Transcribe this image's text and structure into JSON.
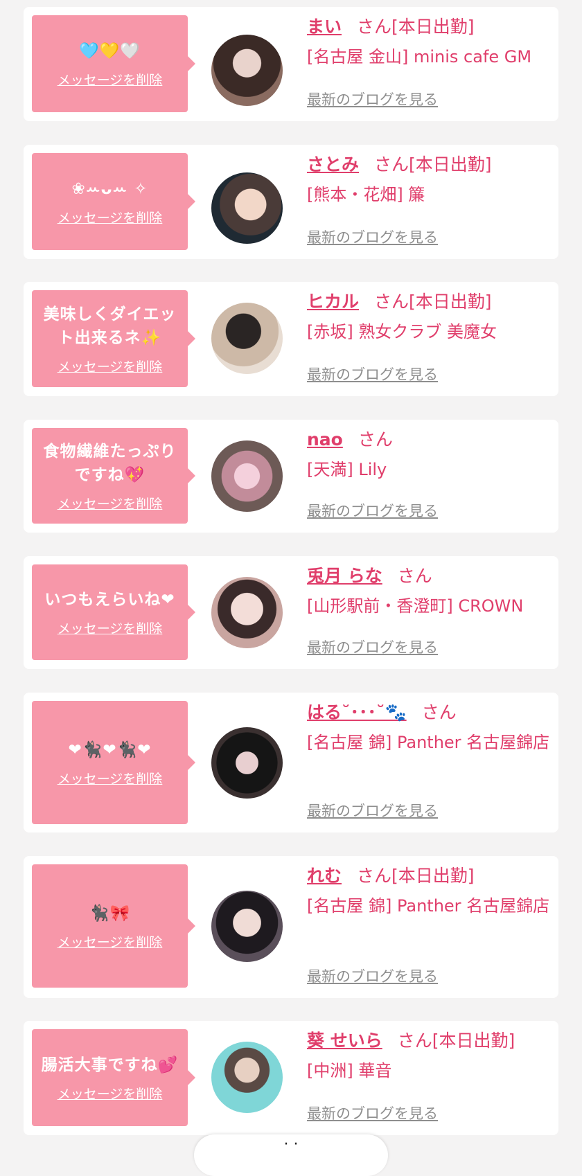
{
  "delete_label": "メッセージを削除",
  "san_suffix": "さん",
  "blog_label": "最新のブログを見る",
  "items": [
    {
      "message": "🩵💛🤍",
      "name": "まい",
      "status": "[本日出勤]",
      "store": "[名古屋 金山] minis cafe GM"
    },
    {
      "message": "❀ꕀᴗꕀ ✧",
      "name": "さとみ",
      "status": "[本日出勤]",
      "store": "[熊本・花畑] 簾"
    },
    {
      "message": "美味しくダイエット出来るネ✨",
      "name": "ヒカル",
      "status": "[本日出勤]",
      "store": "[赤坂] 熟女クラブ 美魔女"
    },
    {
      "message": "食物繊維たっぷりですね💖",
      "name": "nao",
      "status": "",
      "store": "[天満] Lily"
    },
    {
      "message": "いつもえらいね❤",
      "name": "兎月 らな",
      "status": "",
      "store": "[山形駅前・香澄町] CROWN"
    },
    {
      "message": "❤🐈‍⬛❤🐈‍⬛❤",
      "name": "はる˘･･･˘🐾",
      "status": "",
      "store": "[名古屋 錦] Panther 名古屋錦店"
    },
    {
      "message": "🐈‍⬛🎀",
      "name": "れむ",
      "status": "[本日出勤]",
      "store": "[名古屋 錦] Panther 名古屋錦店"
    },
    {
      "message": "腸活大事ですね💕",
      "name": "葵 せいら",
      "status": "[本日出勤]",
      "store": "[中洲] 華音"
    }
  ],
  "bottom_pill_text": "· ·",
  "colors": {
    "bubble": "#f797a9",
    "accent": "#e03e6b",
    "link_gray": "#8e8e8e",
    "background": "#f4f3f3"
  }
}
